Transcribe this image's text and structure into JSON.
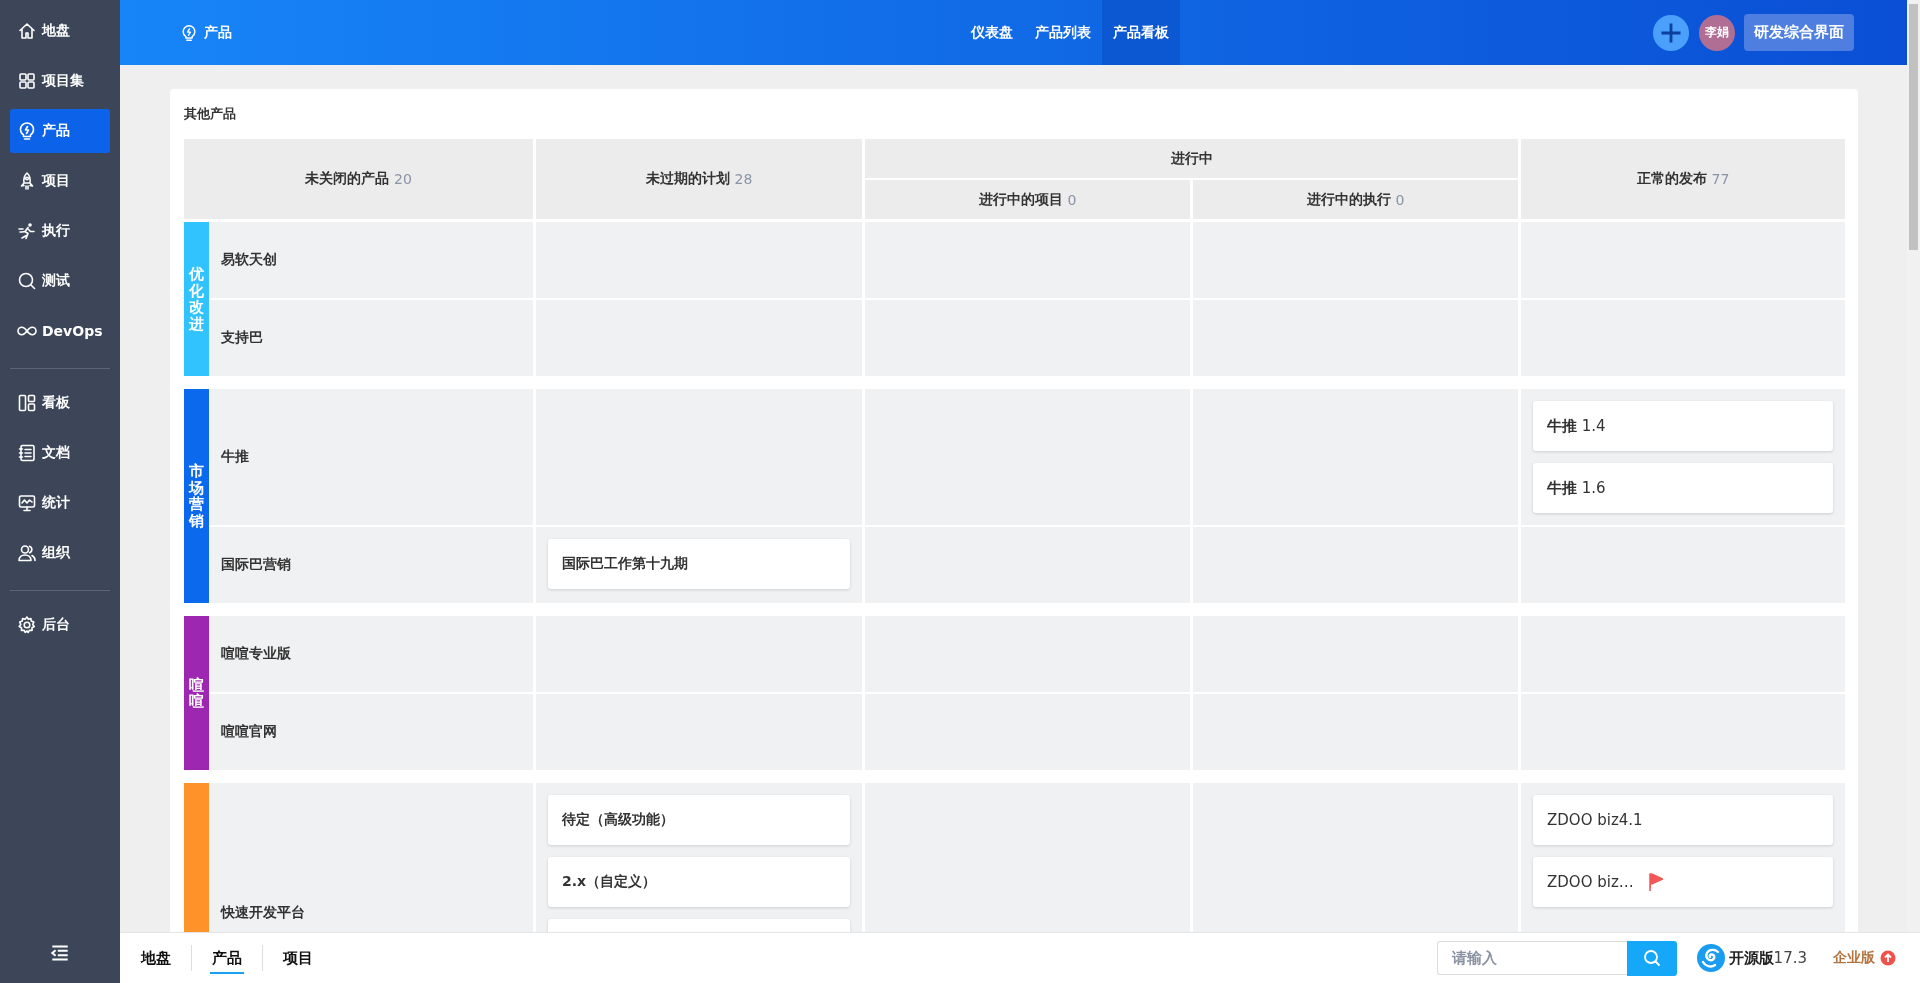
{
  "sidebar": {
    "sections": [
      {
        "items": [
          {
            "kind": "home",
            "label": "地盘",
            "selected": false
          },
          {
            "kind": "grid",
            "label": "项目集",
            "selected": false
          },
          {
            "kind": "bulb",
            "label": "产品",
            "selected": true
          },
          {
            "kind": "rocket",
            "label": "项目",
            "selected": false
          },
          {
            "kind": "runner",
            "label": "执行",
            "selected": false
          },
          {
            "kind": "magnifier",
            "label": "测试",
            "selected": false
          },
          {
            "kind": "infinity",
            "label": "DevOps",
            "selected": false
          }
        ]
      },
      {
        "items": [
          {
            "kind": "board",
            "label": "看板",
            "selected": false
          },
          {
            "kind": "doc",
            "label": "文档",
            "selected": false
          },
          {
            "kind": "monitor",
            "label": "统计",
            "selected": false
          },
          {
            "kind": "people",
            "label": "组织",
            "selected": false
          }
        ]
      },
      {
        "items": [
          {
            "kind": "gear",
            "label": "后台",
            "selected": false
          }
        ]
      }
    ]
  },
  "topbar": {
    "title": "产品",
    "tabs": [
      {
        "label": "仪表盘",
        "selected": false
      },
      {
        "label": "产品列表",
        "selected": false
      },
      {
        "label": "产品看板",
        "selected": true
      }
    ],
    "avatar": "李娟",
    "switch_button": "研发综合界面"
  },
  "board": {
    "title": "其他产品",
    "columns": [
      {
        "label": "未关闭的产品",
        "count": "20"
      },
      {
        "label": "未过期的计划",
        "count": "28"
      },
      {
        "label": "进行中",
        "children": [
          {
            "label": "进行中的项目",
            "count": "0"
          },
          {
            "label": "进行中的执行",
            "count": "0"
          }
        ]
      },
      {
        "label": "正常的发布",
        "count": "77"
      }
    ],
    "groups": [
      {
        "label": "优化改进",
        "color": "#30c3fd",
        "products": [
          {
            "name": "易软天创"
          },
          {
            "name": "支持巴"
          }
        ]
      },
      {
        "label": "市场营销",
        "color": "#0b69ee",
        "products": [
          {
            "name": "牛推",
            "releases": [
              {
                "title": "**牛推** 1.4",
                "flagged": false
              },
              {
                "title": "**牛推** 1.6",
                "flagged": false
              }
            ]
          },
          {
            "name": "国际巴营销",
            "plans": [
              {
                "title": "国际巴工作第十九期"
              }
            ]
          }
        ]
      },
      {
        "label": "喧喧",
        "color": "#9d27b0",
        "products": [
          {
            "name": "喧喧专业版"
          },
          {
            "name": "喧喧官网"
          }
        ]
      },
      {
        "color": "#ff9228",
        "products": [
          {
            "name": "快速开发平台",
            "plans": [
              {
                "title": "待定（高级功能）"
              },
              {
                "title": "2.x（自定义）"
              }
            ],
            "cards_continue_below": true,
            "releases": [
              {
                "title": "ZDOO biz4.1",
                "flagged": false
              },
              {
                "title": "ZDOO biz…",
                "flagged": true
              }
            ]
          }
        ]
      }
    ]
  },
  "bottombar": {
    "tabs": [
      {
        "label": "地盘",
        "selected": false
      },
      {
        "label": "产品",
        "selected": true
      },
      {
        "label": "项目",
        "selected": false
      }
    ],
    "search": {
      "placeholder": "请输入"
    },
    "version": {
      "edition": "开源版",
      "number": "17.3"
    },
    "upgrade": "企业版"
  }
}
